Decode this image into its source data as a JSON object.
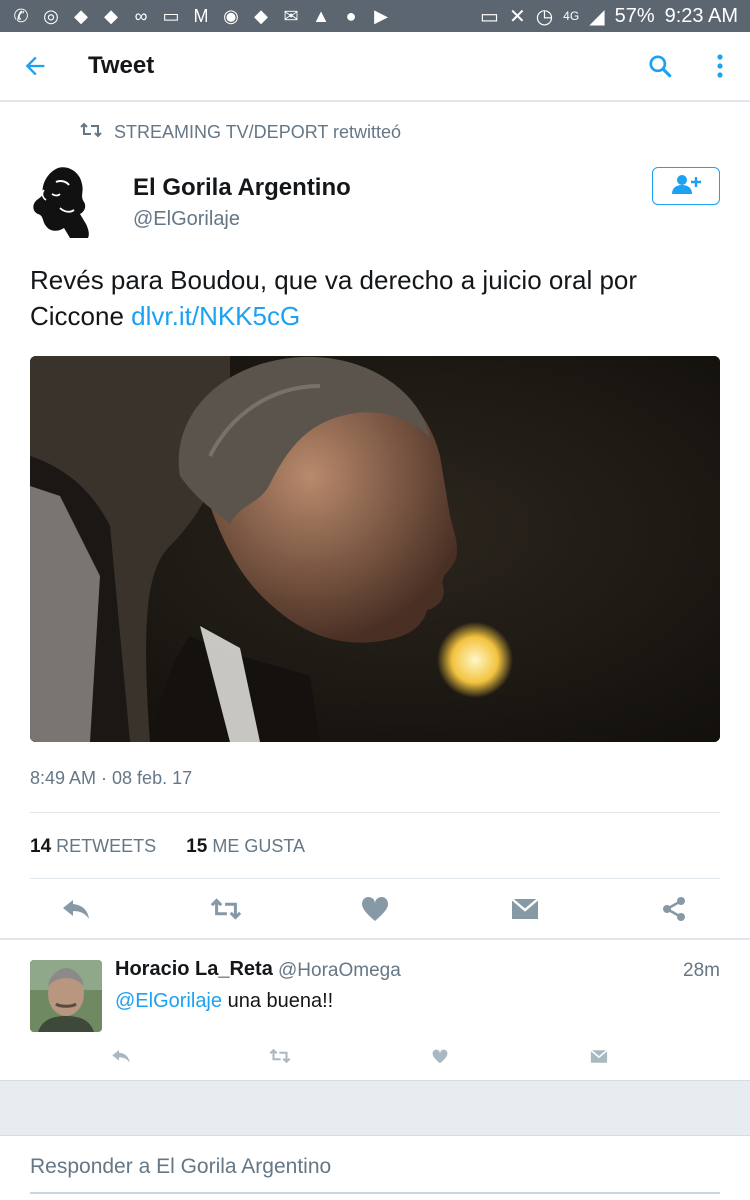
{
  "status_bar": {
    "icons": [
      "missed-call-icon",
      "whatsapp-icon",
      "twitter-icon",
      "twitter-icon",
      "voicemail-icon",
      "cast-icon",
      "gmail-icon",
      "chrome-icon",
      "twitter-icon",
      "mail-icon",
      "warning-icon",
      "app-icon",
      "youtube-icon"
    ],
    "network": "4G",
    "battery": "57%",
    "time": "9:23 AM"
  },
  "app_bar": {
    "back_icon": "back-arrow-icon",
    "title": "Tweet",
    "search_icon": "search-icon",
    "more_icon": "more-vertical-icon"
  },
  "retweet_context": {
    "icon": "retweet-icon",
    "text": "STREAMING TV/DEPORT retwitteó"
  },
  "tweet": {
    "author_name": "El Gorila Argentino",
    "author_handle": "@ElGorilaje",
    "follow_icon": "follow-user-icon",
    "text": "Revés para Boudou, que va derecho a juicio oral por Ciccone ",
    "link": "dlvr.it/NKK5cG",
    "timestamp": "8:49 AM · 08 feb. 17",
    "retweets_count": "14",
    "retweets_label": "RETWEETS",
    "likes_count": "15",
    "likes_label": "ME GUSTA",
    "actions": [
      "reply-icon",
      "retweet-icon",
      "like-icon",
      "direct-message-icon",
      "share-icon"
    ]
  },
  "reply": {
    "name": "Horacio La_Reta",
    "handle": "@HoraOmega",
    "time": "28m",
    "mention": "@ElGorilaje",
    "text": " una buena!!",
    "actions": [
      "reply-icon",
      "retweet-icon",
      "like-icon",
      "direct-message-icon"
    ]
  },
  "compose": {
    "placeholder": "Responder a El Gorila Argentino"
  },
  "colors": {
    "accent": "#1da1f2",
    "status_bar": "#5c6670",
    "muted_text": "#657786",
    "divider": "#e1e8ed"
  }
}
